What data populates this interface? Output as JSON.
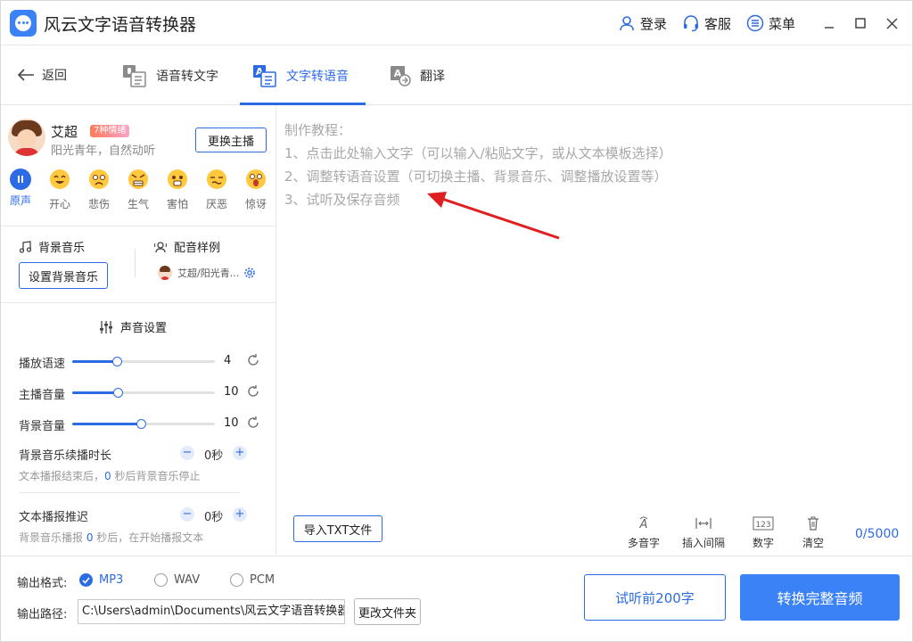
{
  "app": {
    "title": "风云文字语音转换器"
  },
  "titlebar": {
    "login": "登录",
    "service": "客服",
    "menu": "菜单"
  },
  "nav": {
    "back": "返回",
    "tabs": [
      {
        "label": "语音转文字",
        "icon": "speech-to-text-icon"
      },
      {
        "label": "文字转语音",
        "icon": "text-to-speech-icon",
        "active": true
      },
      {
        "label": "翻译",
        "icon": "translate-icon"
      }
    ]
  },
  "voice": {
    "name": "艾超",
    "badge": "7种情绪",
    "desc": "阳光青年，自然动听",
    "change_label": "更换主播",
    "emotions": [
      "原声",
      "开心",
      "悲伤",
      "生气",
      "害怕",
      "厌恶",
      "惊讶"
    ],
    "active_emotion": "原声"
  },
  "bg_music": {
    "label": "背景音乐",
    "button": "设置背景音乐"
  },
  "sample": {
    "label": "配音样例",
    "value": "艾超/阳光青..."
  },
  "sound_settings": {
    "title": "声音设置",
    "sliders": [
      {
        "label": "播放语速",
        "value": "4",
        "fraction": 0.31
      },
      {
        "label": "主播音量",
        "value": "10",
        "fraction": 0.32
      },
      {
        "label": "背景音量",
        "value": "10",
        "fraction": 0.48
      }
    ],
    "bg_duration": {
      "label": "背景音乐续播时长",
      "value": "0秒",
      "hint_pre": "文本播报结束后，",
      "hint_num": "0",
      "hint_post": " 秒后背景音乐停止"
    },
    "text_delay": {
      "label": "文本播报推迟",
      "value": "0秒",
      "hint_pre": "背景音乐播报 ",
      "hint_num": "0",
      "hint_post": " 秒后，在开始播报文本"
    }
  },
  "editor": {
    "lines": [
      "制作教程：",
      "1、点击此处输入文字（可以输入/粘贴文字，或从文本模板选择）",
      "2、调整转语音设置（可切换主播、背景音乐、调整播放设置等）",
      "3、试听及保存音频"
    ],
    "import_label": "导入TXT文件",
    "tools": [
      {
        "label": "多音字",
        "icon": "polyphone-icon"
      },
      {
        "label": "插入间隔",
        "icon": "insert-pause-icon"
      },
      {
        "label": "数字",
        "icon": "number-icon"
      },
      {
        "label": "清空",
        "icon": "trash-icon"
      }
    ],
    "counter": "0/5000"
  },
  "output": {
    "format_label": "输出格式:",
    "formats": [
      "MP3",
      "WAV",
      "PCM"
    ],
    "selected_format": "MP3",
    "path_label": "输出路径:",
    "path_value": "C:\\Users\\admin\\Documents\\风云文字语音转换器",
    "change_folder": "更改文件夹"
  },
  "actions": {
    "preview": "试听前200字",
    "convert": "转换完整音频"
  },
  "colors": {
    "accent": "#2d6be4",
    "annotation_arrow": "#e02020"
  }
}
